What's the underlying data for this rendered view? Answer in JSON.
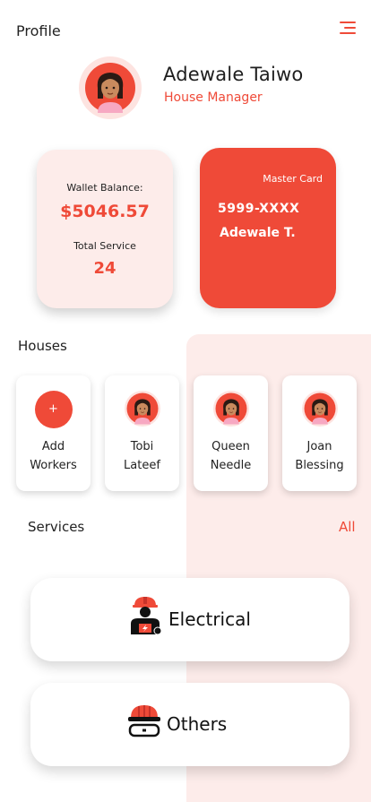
{
  "header": {
    "title": "Profile",
    "menu_icon": "hamburger-menu-icon"
  },
  "profile": {
    "name": "Adewale Taiwo",
    "role": "House Manager",
    "avatar_icon": "user-avatar-icon"
  },
  "wallet": {
    "balance_label": "Wallet Balance:",
    "balance_value": "$5046.57",
    "service_label": "Total Service",
    "service_value": "24"
  },
  "card": {
    "title": "Master Card",
    "number": "5999-XXXX",
    "holder": "Adewale T."
  },
  "houses": {
    "title": "Houses",
    "tiles": [
      {
        "label": "Add\nWorkers",
        "icon": "plus-icon",
        "symbol": "+"
      },
      {
        "label": "Tobi\nLateef",
        "icon": "worker-avatar-icon"
      },
      {
        "label": "Queen\nNeedle",
        "icon": "worker-avatar-icon"
      },
      {
        "label": "Joan\nBlessing",
        "icon": "worker-avatar-icon"
      }
    ]
  },
  "services": {
    "title": "Services",
    "all_label": "All",
    "items": [
      {
        "label": "Electrical",
        "icon": "electrician-icon"
      },
      {
        "label": "Others",
        "icon": "hard-hat-goggles-icon"
      }
    ]
  },
  "colors": {
    "accent": "#ef4a38",
    "accent_soft": "#fdecea",
    "text": "#1e1e1e"
  }
}
